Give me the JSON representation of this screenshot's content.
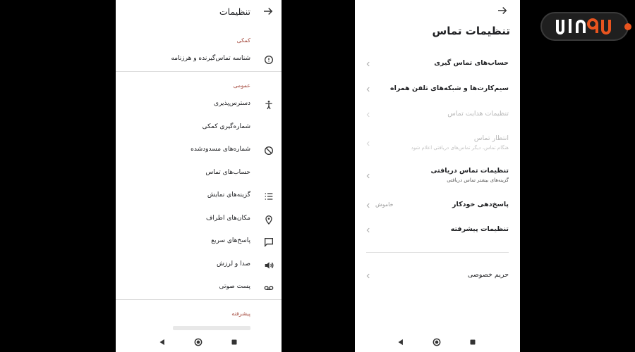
{
  "left": {
    "title": "تنظیمات",
    "sections": {
      "help": "کمکی",
      "general": "عمومی",
      "advanced": "پیشرفته"
    },
    "items": [
      {
        "label": "شناسه تماس‌گیرنده و هرزنامه",
        "icon": "info-icon"
      },
      {
        "label": "دسترس‌پذیری",
        "icon": "accessibility-icon"
      },
      {
        "label": "شماره‌گیری کمکی",
        "icon": ""
      },
      {
        "label": "شماره‌های مسدودشده",
        "icon": "block-icon"
      },
      {
        "label": "حساب‌های تماس",
        "icon": ""
      },
      {
        "label": "گزینه‌های نمایش",
        "icon": "list-icon"
      },
      {
        "label": "مکان‌های اطراف",
        "icon": "location-pin-icon"
      },
      {
        "label": "پاسخ‌های سریع",
        "icon": "message-icon"
      },
      {
        "label": "صدا و لرزش",
        "icon": "volume-icon"
      },
      {
        "label": "پست صوتی",
        "icon": "voicemail-icon"
      }
    ]
  },
  "right": {
    "title": "تنظیمات تماس",
    "items": [
      {
        "label": "حساب‌های تماس گیری",
        "sub": "",
        "value": "",
        "disabled": false
      },
      {
        "label": "سیم‌کارت‌ها و شبکه‌های تلفن همراه",
        "sub": "",
        "value": "",
        "disabled": false
      },
      {
        "label": "تنظیمات هدایت تماس",
        "sub": "",
        "value": "",
        "disabled": true
      },
      {
        "label": "انتظار تماس",
        "sub": "هنگام تماس، دیگر تماس‌های دریافتی اعلام شود",
        "value": "",
        "disabled": true
      },
      {
        "label": "تنظیمات تماس دریافتی",
        "sub": "گزینه‌های بیشتر تماس دریافتی",
        "value": "",
        "disabled": false
      },
      {
        "label": "پاسخ‌دهی خودکار",
        "sub": "",
        "value": "خاموش",
        "disabled": false
      },
      {
        "label": "تنظیمات پیشرفته",
        "sub": "",
        "value": "",
        "disabled": false
      },
      {
        "label": "حریم خصوصی",
        "sub": "",
        "value": "",
        "disabled": false
      }
    ]
  },
  "logo": {
    "text": "19کالا"
  },
  "colors": {
    "section": "#a54b3f",
    "logo_accent": "#e8541f",
    "logo_bg": "#1f1f1f"
  }
}
